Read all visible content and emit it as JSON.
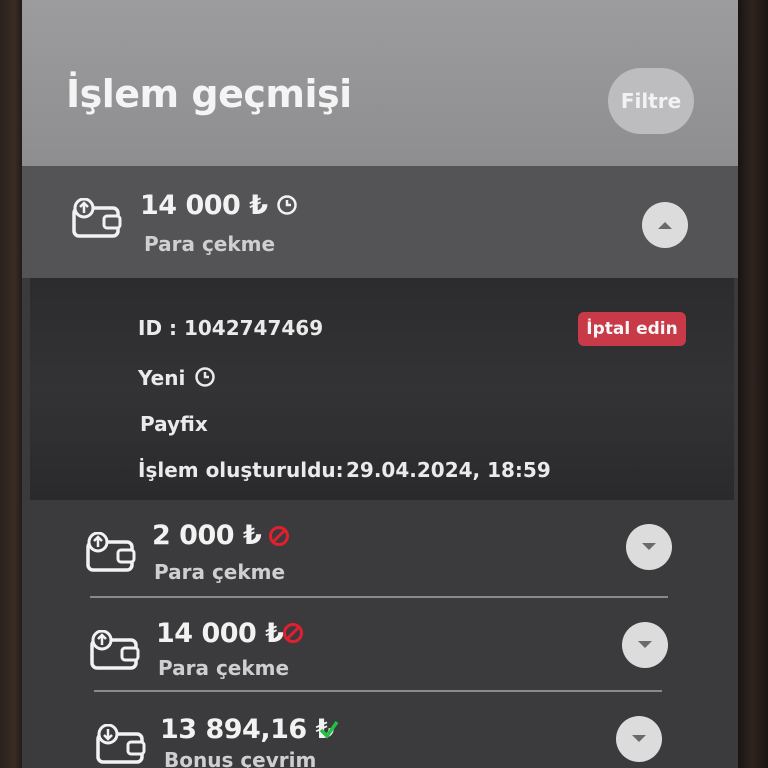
{
  "header": {
    "title": "İşlem geçmişi",
    "filter_label": "Filtre"
  },
  "transactions": [
    {
      "amount": "14 000 ₺",
      "type": "Para çekme",
      "status_icon": "clock-icon",
      "expanded": true,
      "details": {
        "id_label": "ID : 1042747469",
        "status": "Yeni",
        "method": "Payfix",
        "created_label": "İşlem oluşturuldu:",
        "created_value": "29.04.2024, 18:59",
        "cancel_label": "İptal edin"
      }
    },
    {
      "amount": "2 000 ₺",
      "type": "Para çekme",
      "status_icon": "blocked-icon",
      "expanded": false
    },
    {
      "amount": "14 000 ₺",
      "type": "Para çekme",
      "status_icon": "blocked-icon",
      "expanded": false
    },
    {
      "amount": "13 894,16 ₺",
      "type": "Bonus çevrim",
      "status_icon": "check-icon",
      "expanded": false
    }
  ],
  "colors": {
    "header_bg": "#9c9c9e",
    "expanded_row_bg": "#545456",
    "detail_bg": "#2c2c2e",
    "cancel_red": "#c83a48",
    "blocked_red": "#e02030",
    "check_green": "#22c040"
  }
}
